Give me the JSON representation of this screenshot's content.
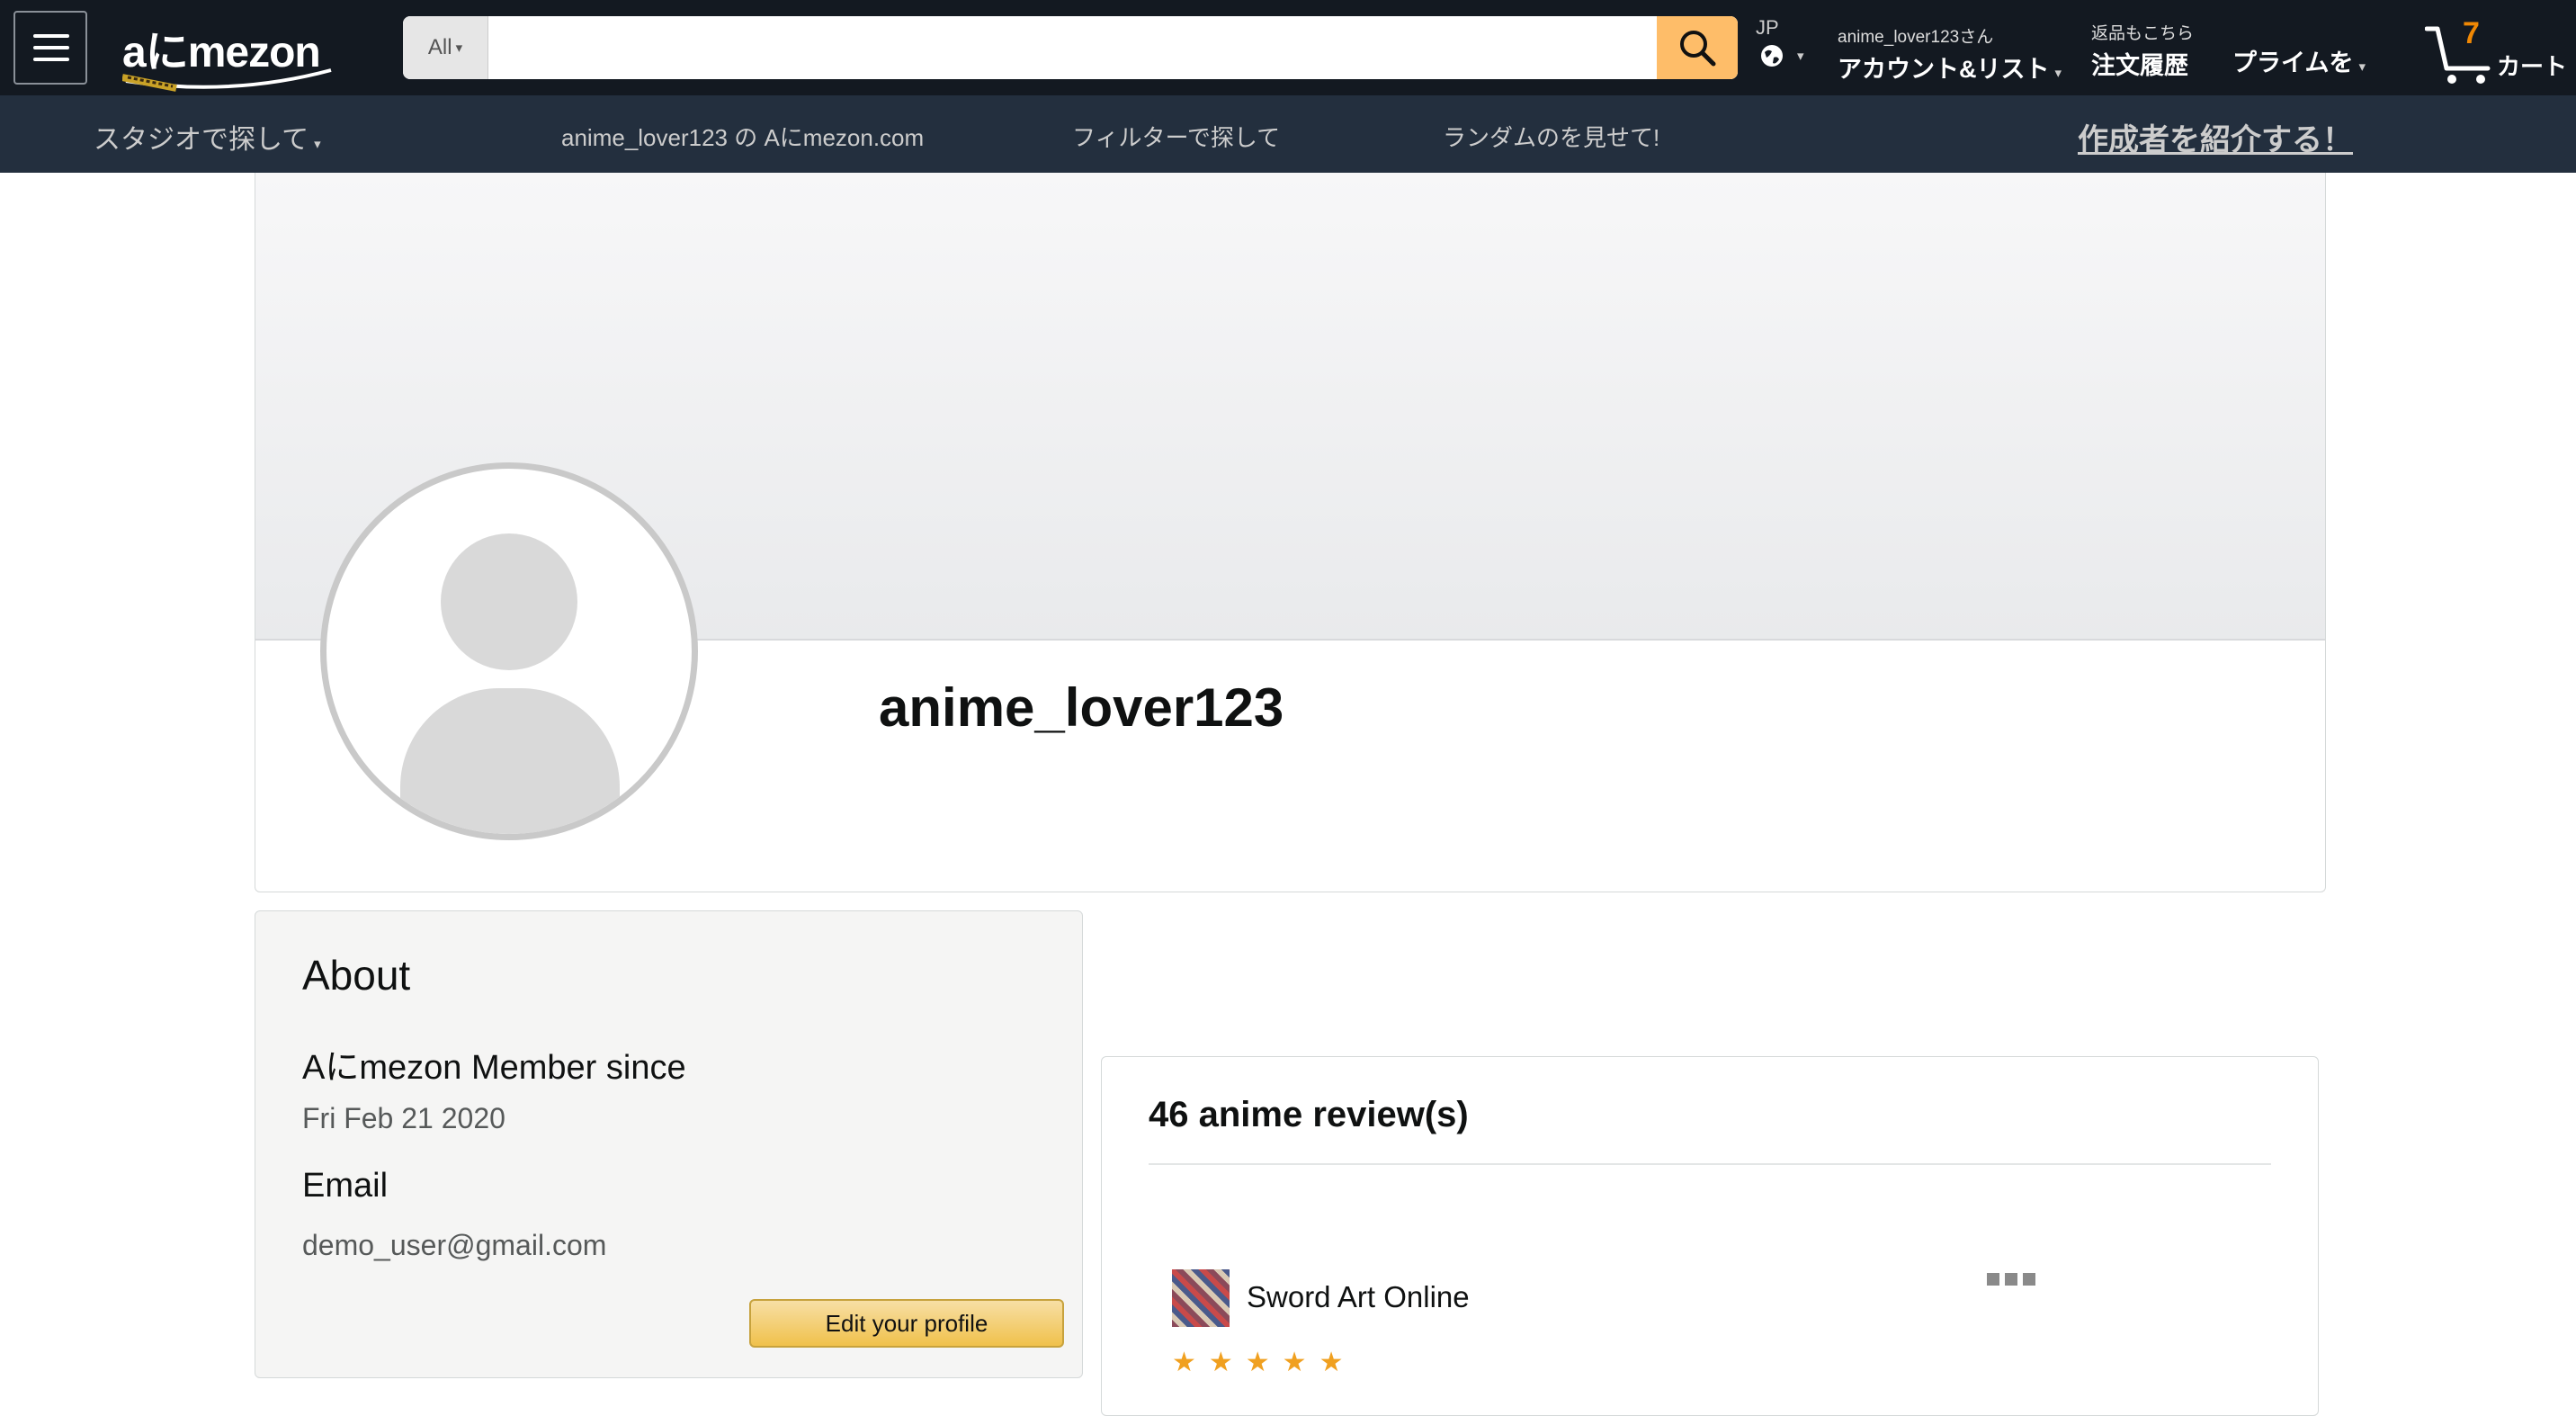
{
  "nav": {
    "logo": "aにmezon",
    "search": {
      "category": "All",
      "placeholder": "",
      "value": ""
    },
    "lang": "JP",
    "account": {
      "greeting": "anime_lover123さん",
      "label": "アカウント&リスト"
    },
    "orders": {
      "small": "返品もこちら",
      "big": "注文履歴"
    },
    "prime": "プライムを",
    "cart": {
      "count": "7",
      "label": "カート"
    }
  },
  "subnav": {
    "studio": "スタジオで探して",
    "mysite": "anime_lover123 の Aにmezon.com",
    "filter": "フィルターで探して",
    "random": "ランダムのを見せて!",
    "creator": "作成者を紹介する！"
  },
  "profile": {
    "username": "anime_lover123"
  },
  "about": {
    "title": "About",
    "member_label": "Aにmezon Member since",
    "member_value": "Fri Feb 21 2020",
    "email_label": "Email",
    "email_value": "demo_user@gmail.com",
    "edit_button": "Edit your profile"
  },
  "reviews": {
    "title": "46 anime review(s)",
    "items": [
      {
        "name": "Sword Art Online",
        "stars": "★★★★★"
      }
    ]
  },
  "colors": {
    "nav_bg": "#131921",
    "subnav_bg": "#232f3e",
    "search_button": "#febd69",
    "cart_count": "#f08804",
    "edit_button": "#f0c14b"
  }
}
